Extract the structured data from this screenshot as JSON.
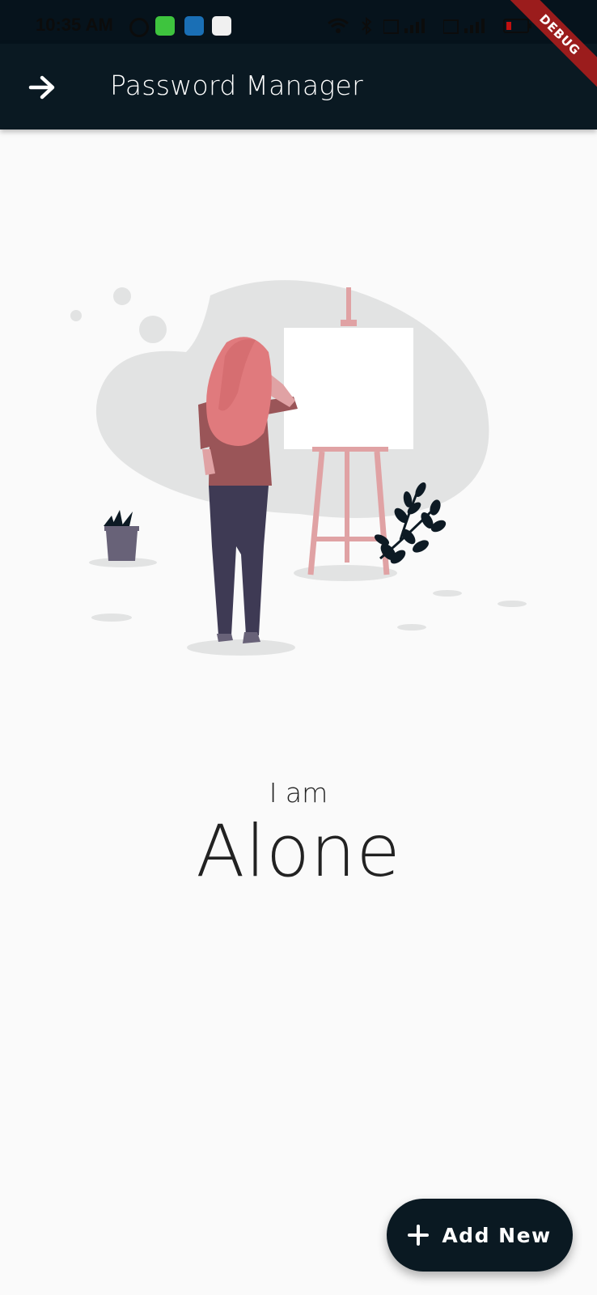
{
  "status_bar": {
    "time": "10:35 AM"
  },
  "app_bar": {
    "back_icon": "arrow-forward-icon",
    "title": "Password Manager"
  },
  "debug_banner": {
    "label": "DEBUG"
  },
  "empty_state": {
    "subtitle": "I am",
    "title": "Alone"
  },
  "fab": {
    "icon": "plus-icon",
    "label": "Add New"
  },
  "colors": {
    "app_bar": "#0a1922",
    "background": "#fafafa",
    "accent_pink": "#e07a7d",
    "ribbon": "#9b1c1c"
  }
}
